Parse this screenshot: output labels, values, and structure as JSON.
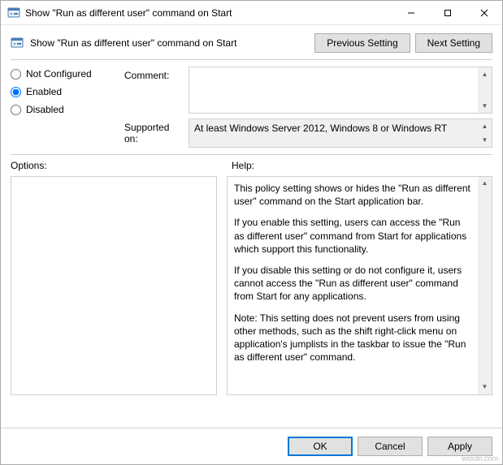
{
  "window": {
    "title": "Show \"Run as different user\" command on Start"
  },
  "header": {
    "title": "Show \"Run as different user\" command on Start",
    "prev_btn": "Previous Setting",
    "next_btn": "Next Setting"
  },
  "radios": {
    "not_configured": "Not Configured",
    "enabled": "Enabled",
    "disabled": "Disabled",
    "selected": "enabled"
  },
  "fields": {
    "comment_label": "Comment:",
    "comment_value": "",
    "supported_label": "Supported on:",
    "supported_value": "At least Windows Server 2012, Windows 8 or Windows RT"
  },
  "panes": {
    "options_label": "Options:",
    "help_label": "Help:"
  },
  "help": {
    "p1": "This policy setting shows or hides the \"Run as different user\" command on the Start application bar.",
    "p2": "If you enable this setting, users can access the \"Run as different user\" command from Start for applications which support this functionality.",
    "p3": "If you disable this setting or do not configure it, users cannot access the \"Run as different user\" command from Start for any applications.",
    "p4": "Note: This setting does not prevent users from using other methods, such as the shift right-click menu on application's jumplists in the taskbar to issue the \"Run as different user\" command."
  },
  "footer": {
    "ok": "OK",
    "cancel": "Cancel",
    "apply": "Apply"
  },
  "corner_url": "wsxdn.com"
}
